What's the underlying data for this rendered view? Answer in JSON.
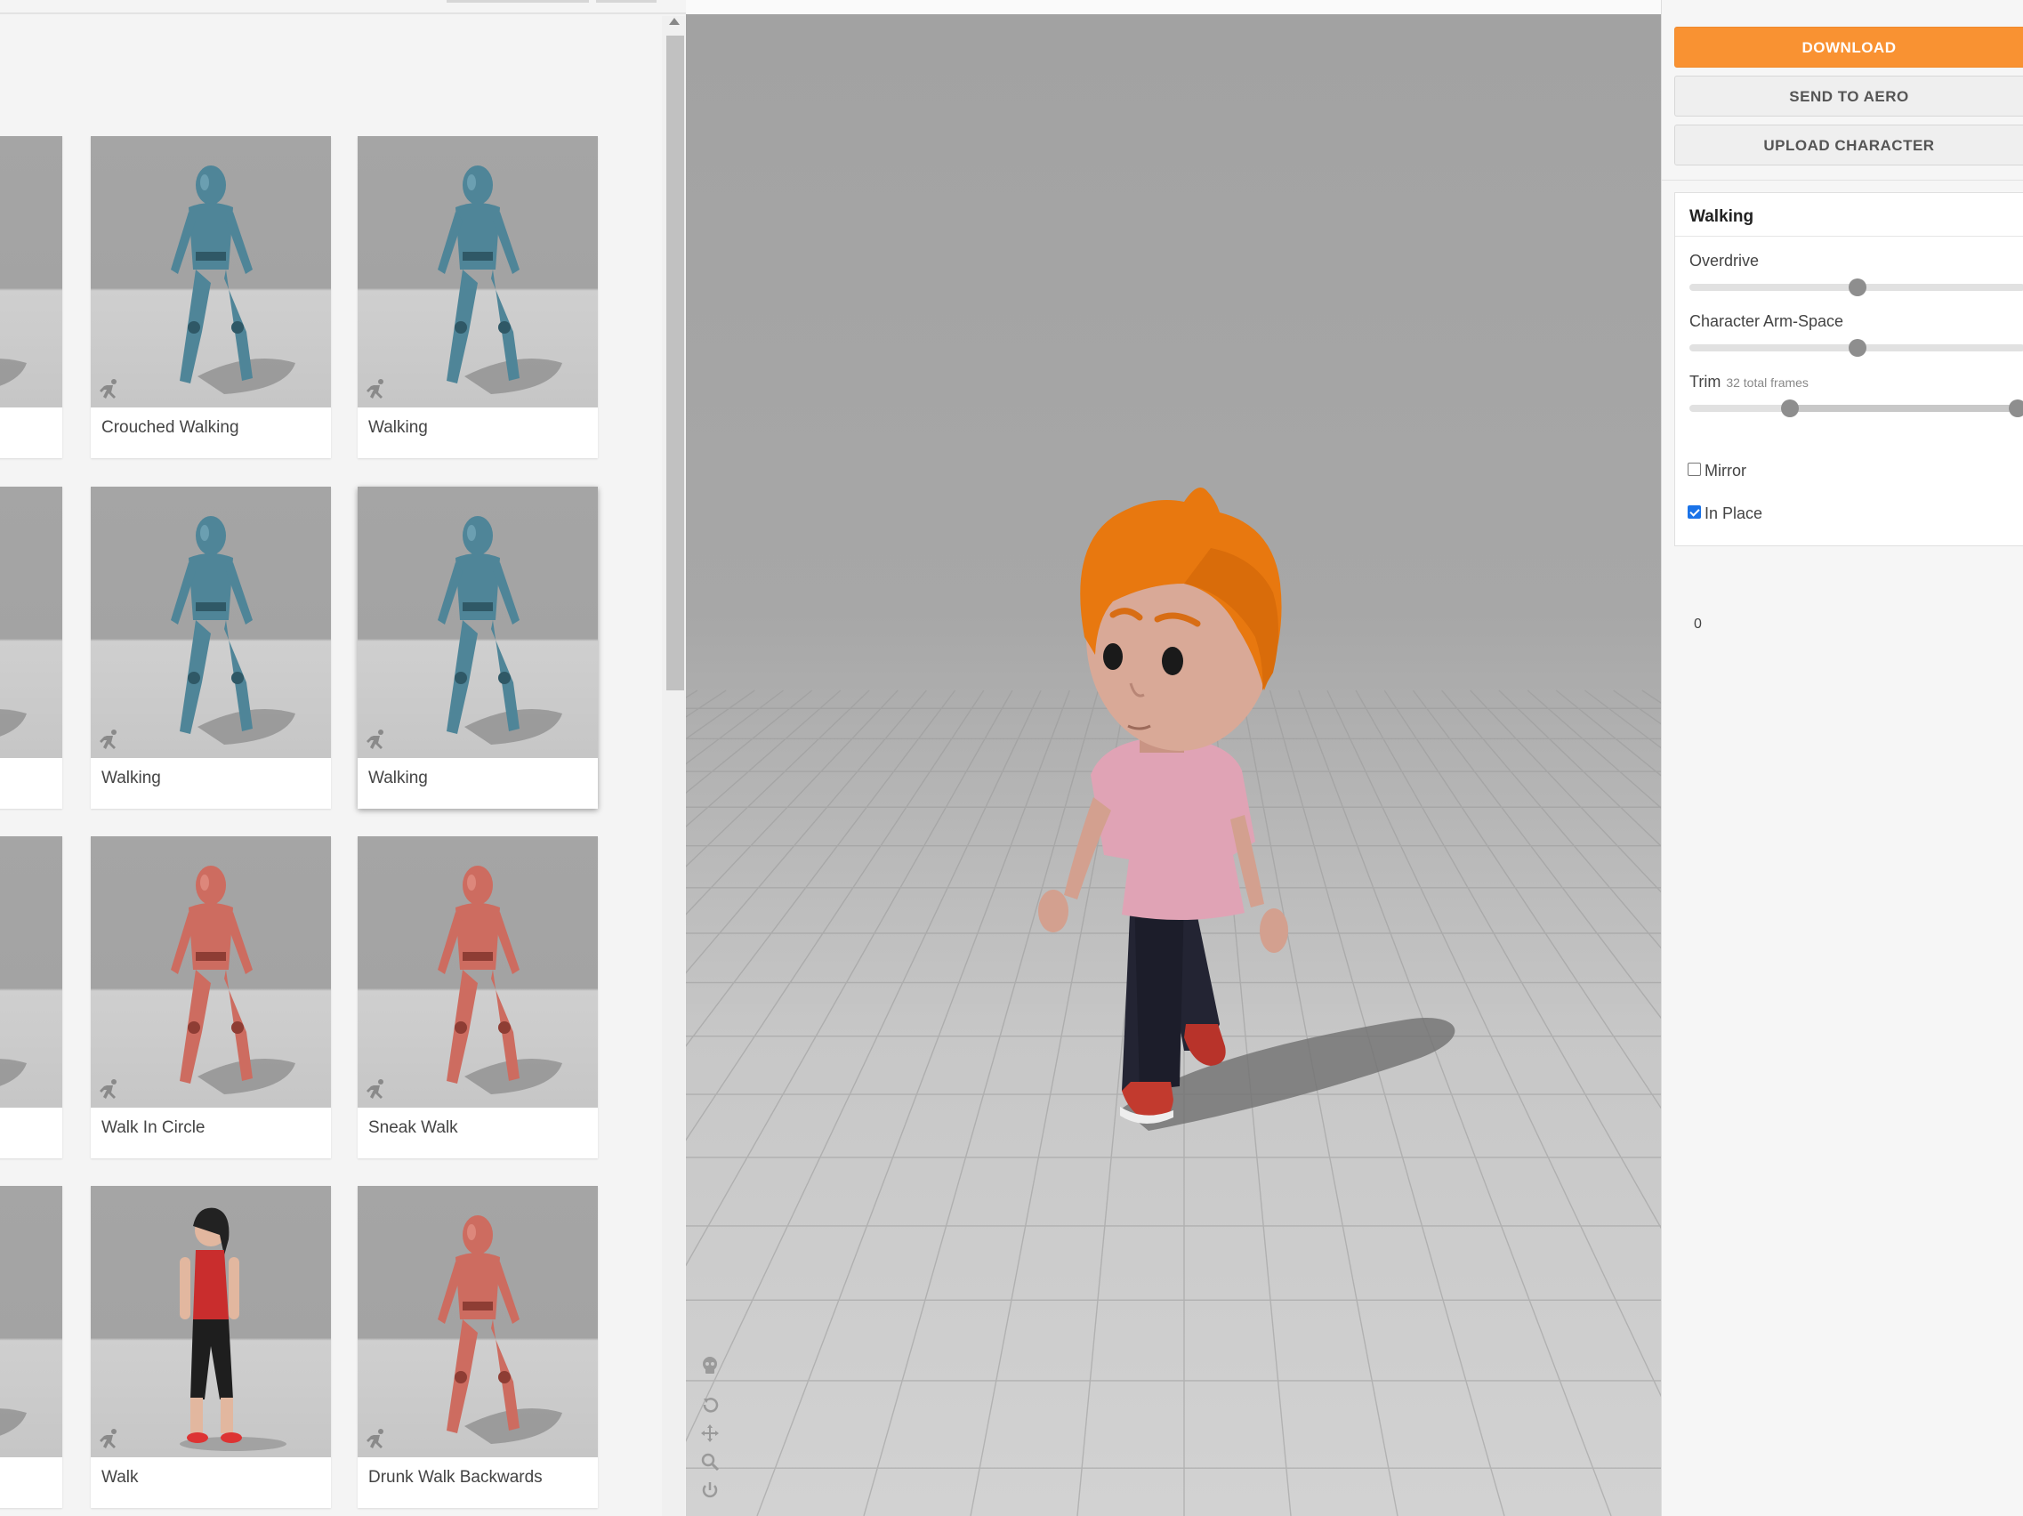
{
  "library": {
    "cards": [
      {
        "label": "",
        "figure": "blue-mannequin"
      },
      {
        "label": "Crouched Walking",
        "figure": "blue-mannequin"
      },
      {
        "label": "Walking",
        "figure": "blue-mannequin"
      },
      {
        "label": "",
        "figure": "blue-mannequin"
      },
      {
        "label": "Walking",
        "figure": "blue-mannequin"
      },
      {
        "label": "Walking",
        "figure": "blue-mannequin",
        "selected": true
      },
      {
        "label": "",
        "figure": "red-mannequin"
      },
      {
        "label": "Walk In Circle",
        "figure": "red-mannequin"
      },
      {
        "label": "Sneak Walk",
        "figure": "red-mannequin"
      },
      {
        "label": "",
        "figure": "red-mannequin"
      },
      {
        "label": "Walk",
        "figure": "woman"
      },
      {
        "label": "Drunk Walk Backwards",
        "figure": "red-mannequin"
      }
    ],
    "card_icon": "running-person-icon"
  },
  "viewport": {
    "tools": [
      "skull-icon",
      "undo-icon",
      "move-icon",
      "zoom-icon",
      "power-icon"
    ],
    "character": "cartoon-boy-orange-hair-pink-shirt"
  },
  "settings": {
    "download_label": "DOWNLOAD",
    "send_label": "SEND TO AERO",
    "upload_label": "UPLOAD CHARACTER",
    "animation_title": "Walking",
    "overdrive": {
      "label": "Overdrive",
      "value": 0.5
    },
    "arm_space": {
      "label": "Character Arm-Space",
      "value": 0.5
    },
    "trim": {
      "label": "Trim",
      "sub": "32 total frames",
      "start": 0.3,
      "end": 0.98,
      "start_value": "0"
    },
    "mirror": {
      "label": "Mirror",
      "checked": false
    },
    "in_place": {
      "label": "In Place",
      "checked": true
    },
    "colors": {
      "accent": "#f99232",
      "checkbox": "#1a73e8"
    }
  }
}
